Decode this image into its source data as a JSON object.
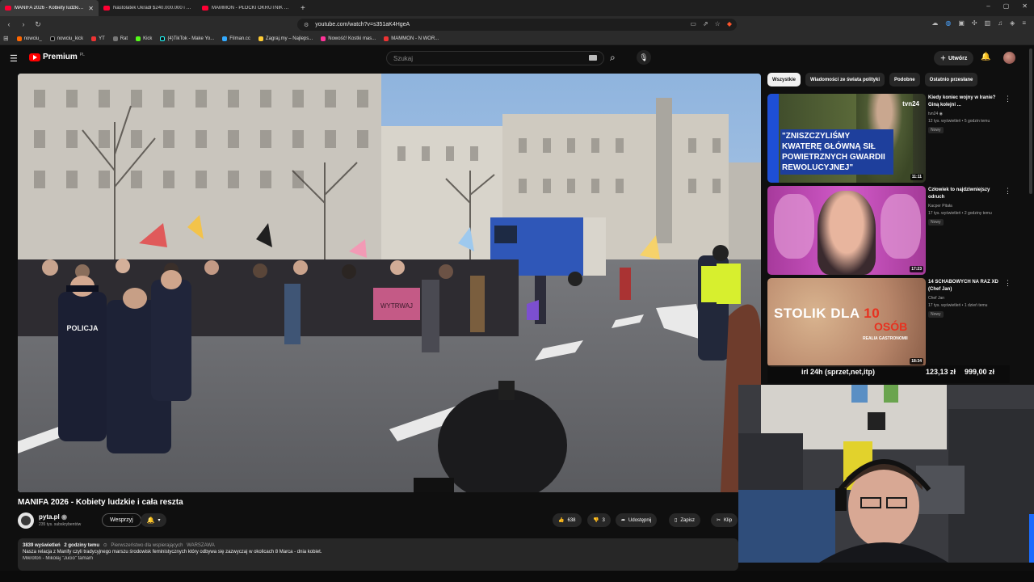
{
  "browser": {
    "tabs": [
      {
        "title": "MANIFA 2026 - Kobiety ludzkie i cała reszta",
        "active": true
      },
      {
        "title": "Nastolatek Ukradł $240.000.000 i Po...",
        "active": false
      },
      {
        "title": "MAMMON - PŁOCKI OKRUTNIK PURE...",
        "active": false
      }
    ],
    "new_tab": "+",
    "window_controls": [
      "–",
      "▢",
      "✕"
    ],
    "url": "youtube.com/watch?v=s351aK4HgeA",
    "bookmarks": [
      "nowciu_",
      "nowciu_kick",
      "YT",
      "Rat",
      "Kick",
      "(4)TikTok - Make Yo...",
      "Filman.cc",
      "Zagraj.my – Najleps...",
      "Nowość! Kostki mas...",
      "MAMMON - N WOR..."
    ]
  },
  "youtube": {
    "logo_text": "Premium",
    "logo_region": "PL",
    "search_placeholder": "Szukaj",
    "create_label": "Utwórz",
    "accent": "#ff0000"
  },
  "video": {
    "title": "MANIFA 2026 - Kobiety ludzkie i cała reszta",
    "channel": "pyta.pl",
    "subscribers": "235 tys. subskrybentów",
    "join_label": "Wesprzyj",
    "likes": "638",
    "dislikes": "3",
    "share_label": "Udostępnij",
    "save_label": "Zapisz",
    "clip_label": "Klip",
    "views": "3839 wyświetleń",
    "posted": "2 godziny temu",
    "premiere_tag": "Pierwszeństwo dla wspierających",
    "location_tag": "WARSZAWA",
    "description": "Nasza relacja z Manify czyli tradycyjnego marszu środowisk feministycznych który odbywa się zazwyczaj w okolicach 8 Marca - dnia kobiet.",
    "description_more": "Mikrofon - Mikołaj \"Jucio\" tamam",
    "scene_sign": "POLICJA",
    "scene_banner": "WYTRWAJ"
  },
  "sidebar": {
    "chips": [
      "Wszystkie",
      "Wiadomości ze świata polityki",
      "Podobne",
      "Ostatnio przesłane"
    ],
    "recs": [
      {
        "title": "Kiedy koniec wojny w Iranie? Giną kolejni ...",
        "channel": "tvn24",
        "meta": "12 tys. wyświetleń • 5 godzin temu",
        "badge": "Nowy",
        "duration": "11:11",
        "thumb_text": "\"ZNISZCZYLIŚMY KWATERĘ GŁÓWNĄ SIŁ POWIETRZNYCH GWARDII REWOLUCYJNEJ\"",
        "thumb_logo": "tvn24"
      },
      {
        "title": "Człowiek to najdziwniejszy odruch",
        "channel": "Kacper Pitała",
        "meta": "17 tys. wyświetleń • 2 godziny temu",
        "badge": "Nowy",
        "duration": "17:23"
      },
      {
        "title": "14 SCHABOWYCH NA RAZ XD (Chef Jan)",
        "channel": "Chef Jan",
        "meta": "17 tys. wyświetleń • 1 dzień temu",
        "badge": "Nowy",
        "duration": "18:34",
        "thumb_text": "STOLIK DLA",
        "thumb_num": "10",
        "thumb_sub": "OSÓB",
        "thumb_tag": "REALIA GASTRONOMII"
      }
    ]
  },
  "overlay": {
    "goal": "irl 24h (sprzet,net,itp)",
    "current": "123,13 zł",
    "target": "999,00 zł"
  }
}
